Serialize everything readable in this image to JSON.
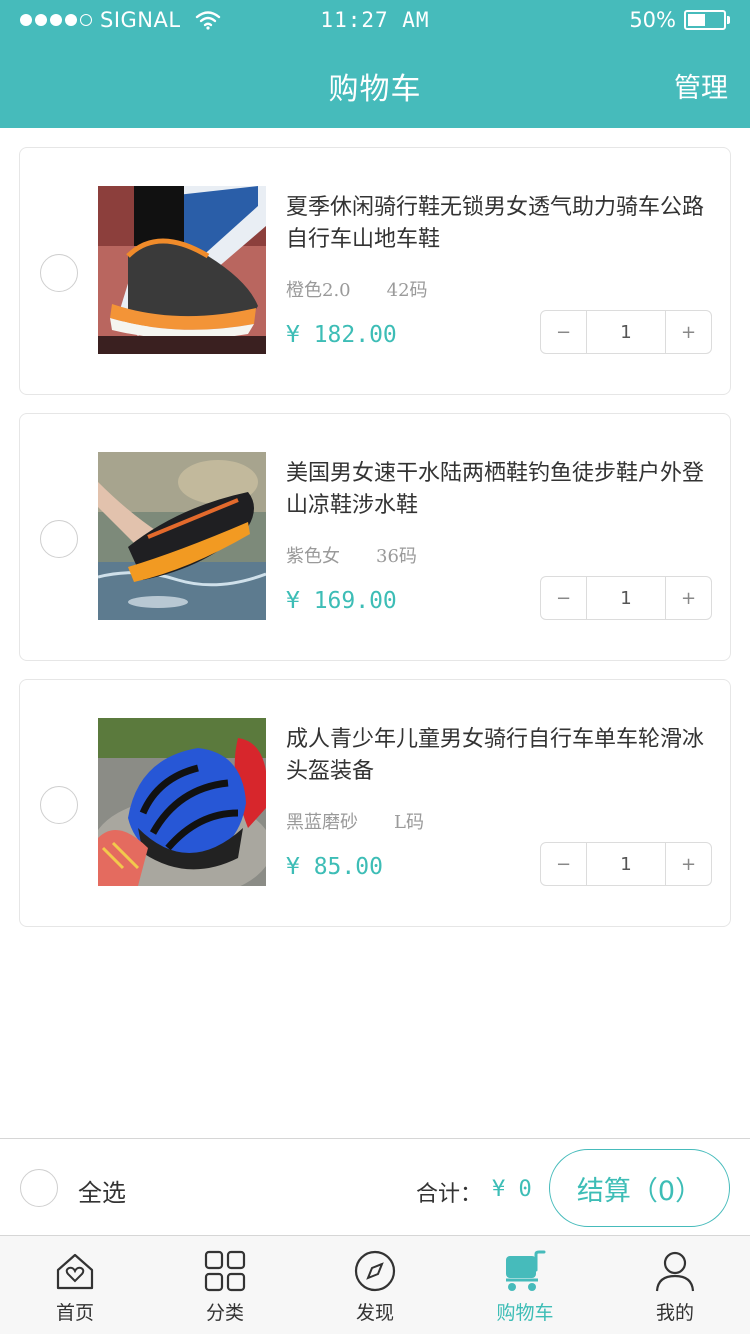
{
  "status_bar": {
    "carrier": "SIGNAL",
    "time": "11:27 AM",
    "battery": "50%",
    "battery_level": 0.5
  },
  "nav": {
    "title": "购物车",
    "manage": "管理"
  },
  "cart": {
    "items": [
      {
        "title": "夏季休闲骑行鞋无锁男女透气助力骑车公路自行车山地车鞋",
        "color": "橙色2.0",
        "size": "42码",
        "price": "¥ 182.00",
        "qty": "1",
        "image": "cycling-shoe-photo"
      },
      {
        "title": "美国男女速干水陆两栖鞋钓鱼徒步鞋户外登山凉鞋涉水鞋",
        "color": "紫色女",
        "size": "36码",
        "price": "¥ 169.00",
        "qty": "1",
        "image": "water-shoe-photo"
      },
      {
        "title": "成人青少年儿童男女骑行自行车单车轮滑冰头盔装备",
        "color": "黑蓝磨砂",
        "size": "L码",
        "price": "¥ 85.00",
        "qty": "1",
        "image": "helmet-photo"
      }
    ],
    "minus": "−",
    "plus": "+"
  },
  "checkout": {
    "select_all": "全选",
    "total_label": "合计：",
    "total_value": "¥ 0",
    "button": "结算（0）"
  },
  "tabs": [
    {
      "label": "首页",
      "icon": "home-icon"
    },
    {
      "label": "分类",
      "icon": "grid-icon"
    },
    {
      "label": "发现",
      "icon": "compass-icon"
    },
    {
      "label": "购物车",
      "icon": "cart-icon",
      "active": true
    },
    {
      "label": "我的",
      "icon": "user-icon"
    }
  ],
  "colors": {
    "accent": "#46bbbb",
    "price": "#3dbdb6",
    "border": "#e6e6e6"
  }
}
